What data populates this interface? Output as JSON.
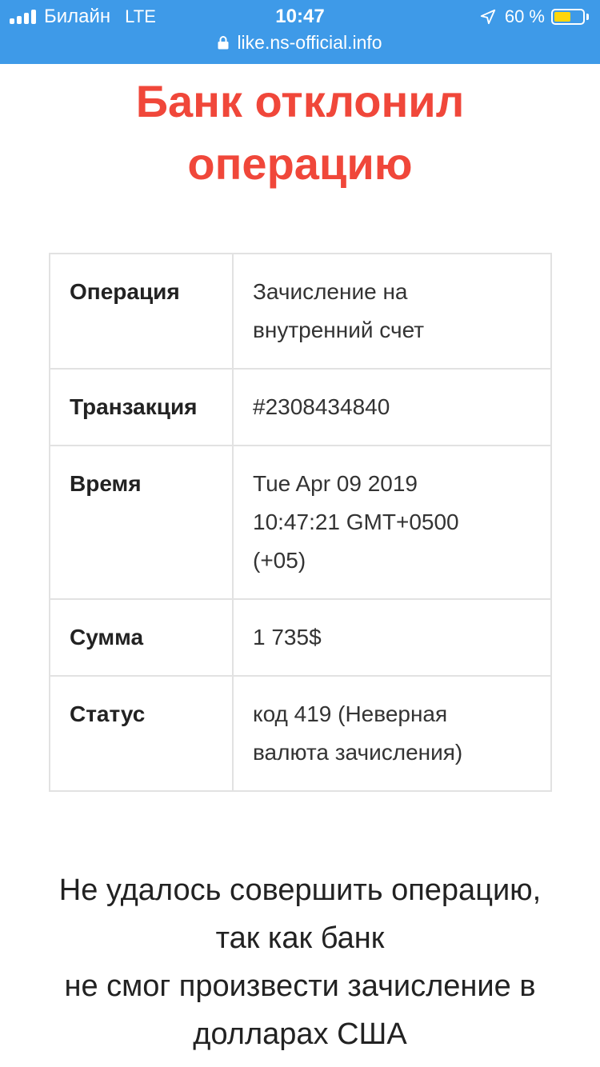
{
  "status_bar": {
    "carrier": "Билайн",
    "network": "LTE",
    "time": "10:47",
    "battery_percent": "60 %",
    "battery_level": 0.6,
    "url": "like.ns-official.info",
    "icons": [
      "signal-icon",
      "location-arrow-icon",
      "battery-icon",
      "lock-icon"
    ],
    "colors": {
      "bar": "#3e9ae8",
      "battery_fill": "#ffd60a"
    }
  },
  "headline": {
    "line1": "Банк отклонил",
    "line2": "операцию",
    "color": "#f0473a"
  },
  "details": {
    "rows": [
      {
        "label": "Операция",
        "value_lines": [
          "Зачисление на",
          "внутренний счет"
        ]
      },
      {
        "label": "Транзакция",
        "value_lines": [
          "#2308434840"
        ]
      },
      {
        "label": "Время",
        "value_lines": [
          "Tue Apr 09 2019",
          "10:47:21 GMT+0500",
          "(+05)"
        ]
      },
      {
        "label": "Сумма",
        "value_lines": [
          "1 735$"
        ]
      },
      {
        "label": "Статус",
        "value_lines": [
          "код 419 (Неверная",
          "валюта зачисления)"
        ]
      }
    ]
  },
  "message": {
    "lines": [
      "Не удалось совершить операцию,",
      "так как банк",
      "не смог произвести зачисление в",
      "долларах США"
    ]
  }
}
